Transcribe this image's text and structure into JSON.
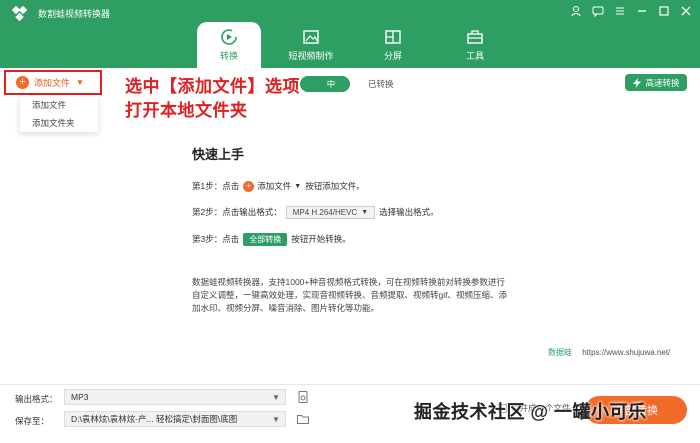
{
  "app": {
    "title": "数割蛙视频转换器"
  },
  "colors": {
    "brand": "#2e9e63",
    "accent": "#f26a2a",
    "annotation": "#e02020"
  },
  "nav": {
    "tabs": [
      {
        "label": "转换",
        "icon": "convert-icon",
        "active": true
      },
      {
        "label": "短视频制作",
        "icon": "video-make-icon",
        "active": false
      },
      {
        "label": "分屏",
        "icon": "split-screen-icon",
        "active": false
      },
      {
        "label": "工具",
        "icon": "toolbox-icon",
        "active": false
      }
    ]
  },
  "toolbar": {
    "add_file_label": "添加文件",
    "menu": [
      "添加文件",
      "添加文件夹"
    ],
    "seg_active_label": "中",
    "seg_converted_label": "已转换",
    "fast_convert_label": "高速转换"
  },
  "annotation": {
    "line1": "选中【添加文件】选项",
    "line2": "打开本地文件夹"
  },
  "quickstart": {
    "title": "快速上手",
    "step1_prefix": "第1步：点击",
    "step1_button": "添加文件",
    "step1_suffix": "按钮添加文件。",
    "step2_prefix": "第2步：点击输出格式：",
    "step2_format": "MP4 H.264/HEVC",
    "step2_suffix": "选择输出格式。",
    "step3_prefix": "第3步：点击",
    "step3_button": "全部转换",
    "step3_suffix": "按钮开始转换。",
    "description": "数据蛙视频转换器，支持1000+种音视频格式转换，可在视频转换前对转换参数进行自定义调整，一键高效处理，实现音视频转换、音频提取、视频转gif、视频压缩、添加水印、视频分屏、噪音消除、图片转化等功能。",
    "site_brand": "数据蛙",
    "site_url": "https://www.shujuwa.net/"
  },
  "bottom": {
    "output_format_label": "输出格式：",
    "output_format_value": "MP3",
    "save_to_label": "保存至：",
    "save_to_value": "D:\\袁林炫\\袁林炫-产...  轻松搞定\\封面图\\底图",
    "merge_label": "合并成一个文件",
    "convert_all_label": "全部转换"
  },
  "watermark": "掘金技术社区 @ 一罐小可乐"
}
